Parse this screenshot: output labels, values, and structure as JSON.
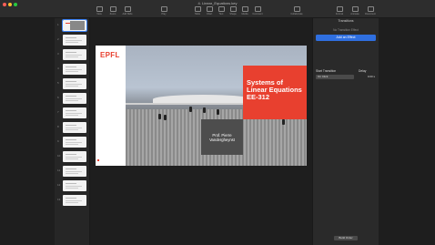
{
  "window": {
    "title": "4. Linear_Equations.key",
    "toolbar": [
      "View",
      "Zoom",
      "Add Slide",
      "Play",
      "Table",
      "Chart",
      "Text",
      "Shape",
      "Media",
      "Comment",
      "Collaborate",
      "Format",
      "Animate",
      "Document"
    ]
  },
  "navigator": {
    "slide_numbers": [
      "1",
      "2",
      "3",
      "4",
      "5",
      "6",
      "7",
      "8",
      "9",
      "10",
      "11",
      "12",
      "13"
    ],
    "selected": 1
  },
  "slide": {
    "logo": "EPFL",
    "title": "Systems of Linear Equations EE-312",
    "presenter": "Prof. Pierre Vandergheynst"
  },
  "inspector": {
    "header": "Transitions",
    "subtitle": "No Transition Effect",
    "add_effect": "Add an Effect",
    "start_label": "Start Transition",
    "start_value": "On Click",
    "delay_label": "Delay",
    "delay_value": "0.00 s",
    "build_order": "Build Order"
  },
  "colors": {
    "accent": "#2f6fe0",
    "epfl_red": "#e8402f"
  }
}
